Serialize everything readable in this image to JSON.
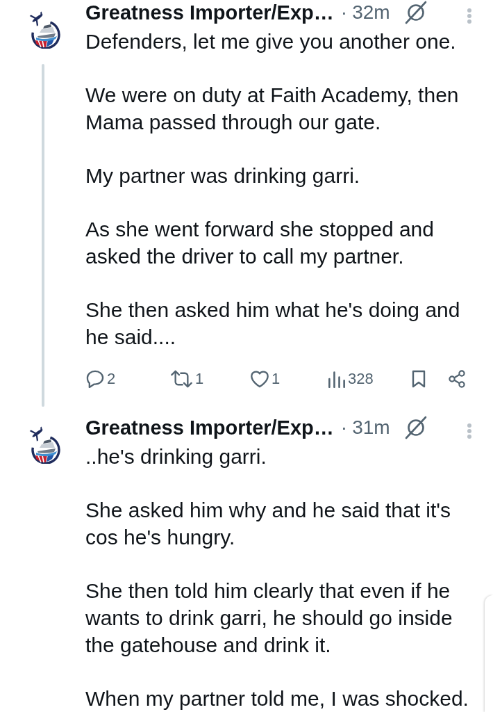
{
  "posts": [
    {
      "author": "Greatness Importer/Exp…",
      "separator": "·",
      "time": "32m",
      "thread_line": true,
      "paragraphs": [
        "Defenders, let me give you another one.",
        "We were on duty at Faith Academy, then Mama passed through our gate.",
        "My partner was drinking garri.",
        "As she went forward she stopped and asked the driver to call my partner.",
        "She then asked him what he's doing and he said...."
      ],
      "actions": [
        {
          "kind": "reply",
          "count": "2"
        },
        {
          "kind": "repost",
          "count": "1"
        },
        {
          "kind": "like",
          "count": "1"
        },
        {
          "kind": "views",
          "count": "328"
        },
        {
          "kind": "bookmark"
        },
        {
          "kind": "share"
        }
      ]
    },
    {
      "author": "Greatness Importer/Exp…",
      "separator": "·",
      "time": "31m",
      "thread_line": false,
      "paragraphs": [
        "..he's drinking garri.",
        "She asked him why and he said that it's cos he's hungry.",
        "She then told him clearly that even if he wants to drink garri, he should go inside the gatehouse and drink it.",
        "When my partner told me, I was shocked."
      ]
    }
  ]
}
